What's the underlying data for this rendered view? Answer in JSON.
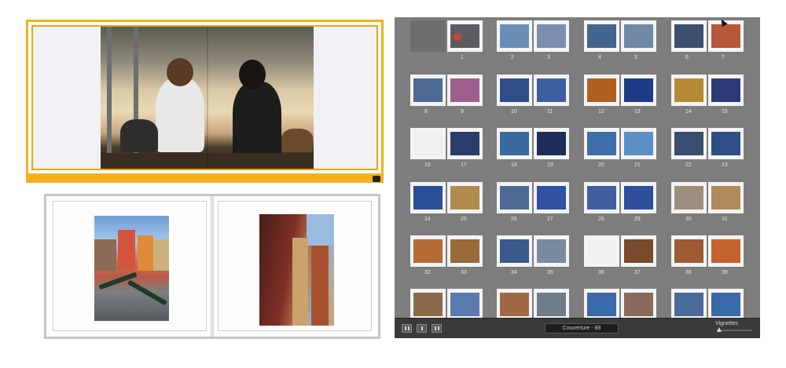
{
  "book_module": {
    "page_indicator": "Couverture - 88",
    "thumbnail_label": "Vignettes",
    "view_buttons": [
      "multi-page-view",
      "spread-view",
      "single-page-view"
    ]
  },
  "spreads": [
    {
      "pages": [
        "",
        "1"
      ],
      "colors": [
        [
          "#6b6b6b"
        ],
        [
          "#5c5c60",
          "#c94040"
        ]
      ]
    },
    {
      "pages": [
        "2",
        "3"
      ],
      "colors": [
        [
          "#6a8fb6"
        ],
        [
          "#7a8fae"
        ]
      ]
    },
    {
      "pages": [
        "4",
        "5"
      ],
      "colors": [
        [
          "#41668f"
        ],
        [
          "#6f8aa6"
        ]
      ]
    },
    {
      "pages": [
        "6",
        "7"
      ],
      "colors": [
        [
          "#3c4f6f"
        ],
        [
          "#b5583b"
        ]
      ]
    },
    {
      "pages": [
        "8",
        "9"
      ],
      "colors": [
        [
          "#4d6a95"
        ],
        [
          "#9e5f8c"
        ]
      ]
    },
    {
      "pages": [
        "10",
        "11"
      ],
      "colors": [
        [
          "#2e4f86"
        ],
        [
          "#3d5fa0"
        ]
      ]
    },
    {
      "pages": [
        "12",
        "13"
      ],
      "colors": [
        [
          "#b05e1e"
        ],
        [
          "#1b3b87"
        ]
      ]
    },
    {
      "pages": [
        "14",
        "15"
      ],
      "colors": [
        [
          "#b58a35"
        ],
        [
          "#2c3b78"
        ]
      ]
    },
    {
      "pages": [
        "16",
        "17"
      ],
      "colors": [
        [
          "#f0f0f0"
        ],
        [
          "#2b3d6b"
        ]
      ]
    },
    {
      "pages": [
        "18",
        "19"
      ],
      "colors": [
        [
          "#3a6b9e"
        ],
        [
          "#1f2d58"
        ]
      ]
    },
    {
      "pages": [
        "20",
        "21"
      ],
      "colors": [
        [
          "#3f6fa9"
        ],
        [
          "#5c8fc4"
        ]
      ]
    },
    {
      "pages": [
        "22",
        "23"
      ],
      "colors": [
        [
          "#3a4c70"
        ],
        [
          "#2e4f86"
        ]
      ]
    },
    {
      "pages": [
        "24",
        "25"
      ],
      "colors": [
        [
          "#2a4f98"
        ],
        [
          "#b08a4e"
        ]
      ]
    },
    {
      "pages": [
        "26",
        "27"
      ],
      "colors": [
        [
          "#4d6a95"
        ],
        [
          "#3050a0"
        ]
      ]
    },
    {
      "pages": [
        "28",
        "29"
      ],
      "colors": [
        [
          "#3f5f9e"
        ],
        [
          "#2c4f9a"
        ]
      ]
    },
    {
      "pages": [
        "30",
        "31"
      ],
      "colors": [
        [
          "#9c8f80"
        ],
        [
          "#b08a5c"
        ]
      ]
    },
    {
      "pages": [
        "32",
        "33"
      ],
      "colors": [
        [
          "#b56a35"
        ],
        [
          "#9a6a3a"
        ]
      ]
    },
    {
      "pages": [
        "34",
        "35"
      ],
      "colors": [
        [
          "#3a5a8a"
        ],
        [
          "#7a8aa0"
        ]
      ]
    },
    {
      "pages": [
        "36",
        "37"
      ],
      "colors": [
        [
          "#f0f0f0"
        ],
        [
          "#7a4a2a"
        ]
      ]
    },
    {
      "pages": [
        "38",
        "39"
      ],
      "colors": [
        [
          "#9e5a35"
        ],
        [
          "#c4622d"
        ]
      ]
    },
    {
      "pages": [
        "",
        ""
      ],
      "colors": [
        [
          "#8a6a4a"
        ],
        [
          "#5a7ab0"
        ]
      ]
    },
    {
      "pages": [
        "",
        ""
      ],
      "colors": [
        [
          "#9e6a45"
        ],
        [
          "#6d7d8a"
        ]
      ]
    },
    {
      "pages": [
        "",
        ""
      ],
      "colors": [
        [
          "#3a6aa8"
        ],
        [
          "#8a6a5a"
        ]
      ]
    },
    {
      "pages": [
        "",
        ""
      ],
      "colors": [
        [
          "#4a6a9a"
        ],
        [
          "#3a6aa8"
        ]
      ]
    }
  ]
}
